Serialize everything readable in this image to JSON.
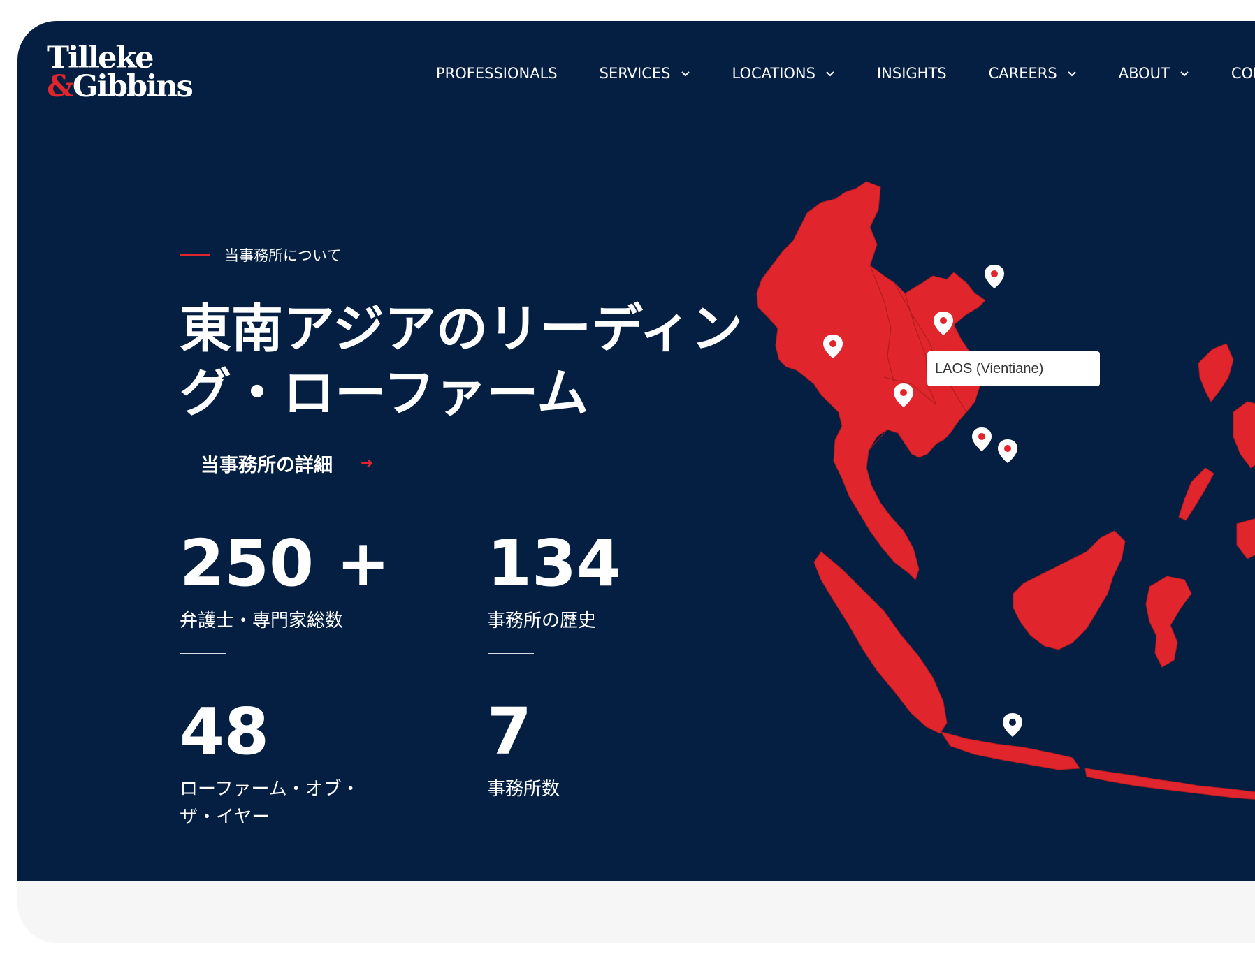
{
  "brand": {
    "line1": "Tilleke",
    "amp": "&",
    "line2": "Gibbins"
  },
  "nav": [
    {
      "label": "PROFESSIONALS",
      "dropdown": false
    },
    {
      "label": "SERVICES",
      "dropdown": true
    },
    {
      "label": "LOCATIONS",
      "dropdown": true
    },
    {
      "label": "INSIGHTS",
      "dropdown": false
    },
    {
      "label": "CAREERS",
      "dropdown": true
    },
    {
      "label": "ABOUT",
      "dropdown": true
    },
    {
      "label": "CON",
      "dropdown": false
    }
  ],
  "hero": {
    "eyebrow": "当事務所について",
    "title_line1": "東南アジアのリーディン",
    "title_line2": "グ・ローファーム",
    "detail_link": "当事務所の詳細",
    "detail_arrow": "➔"
  },
  "stats": [
    {
      "value": "250 +",
      "label": "弁護士・専門家総数"
    },
    {
      "value": "134",
      "label": "事務所の歴史"
    },
    {
      "value": "48",
      "label_line1": "ローファーム・オブ・",
      "label_line2": "ザ・イヤー"
    },
    {
      "value": "7",
      "label": "事務所数"
    }
  ],
  "map": {
    "tooltip": "LAOS (Vientiane)",
    "land_color": "#e0262c",
    "background_color": "#041f42",
    "pin_icon": "map-pin-icon"
  },
  "colors": {
    "accent": "#e0262c",
    "navy": "#041f42"
  }
}
